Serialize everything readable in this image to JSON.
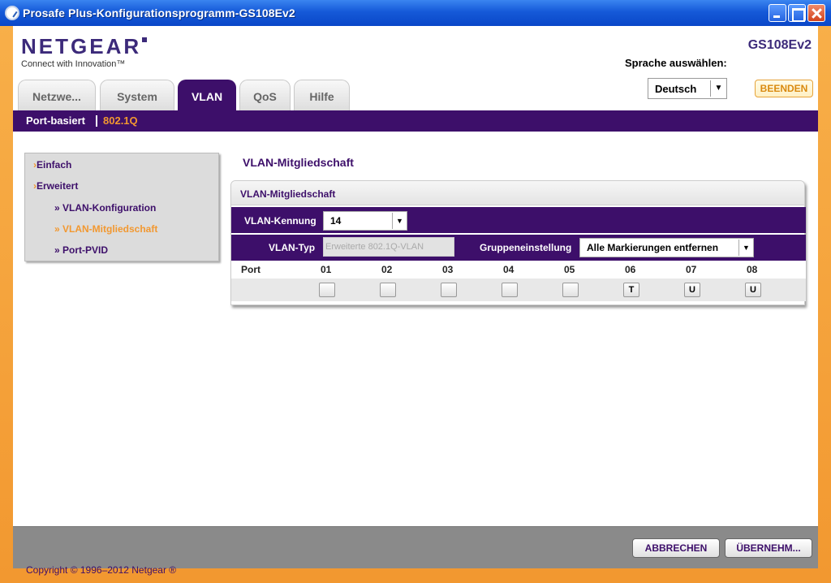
{
  "window": {
    "title": "Prosafe Plus-Konfigurationsprogramm-GS108Ev2"
  },
  "header": {
    "brand": "NETGEAR",
    "tagline": "Connect with Innovation™",
    "model": "GS108Ev2",
    "language_label": "Sprache auswählen:",
    "language_value": "Deutsch",
    "quit_label": "BEENDEN"
  },
  "tabs": [
    {
      "label": "Netzwe..."
    },
    {
      "label": "System"
    },
    {
      "label": "VLAN",
      "active": true
    },
    {
      "label": "QoS"
    },
    {
      "label": "Hilfe"
    }
  ],
  "subnav": {
    "items": [
      "Port-basiert",
      "802.1Q"
    ],
    "active": "802.1Q"
  },
  "sidebar": {
    "items": [
      {
        "label": "Einfach"
      },
      {
        "label": "Erweitert"
      },
      {
        "label": "» VLAN-Konfiguration"
      },
      {
        "label": "» VLAN-Mitgliedschaft",
        "current": true
      },
      {
        "label": "» Port-PVID"
      }
    ]
  },
  "content": {
    "title": "VLAN-Mitgliedschaft",
    "panel_title": "VLAN-Mitgliedschaft",
    "vlan_id_label": "VLAN-Kennung",
    "vlan_id_value": "14",
    "vlan_type_label": "VLAN-Typ",
    "vlan_type_value": "Erweiterte 802.1Q-VLAN",
    "group_label": "Gruppeneinstellung",
    "group_value": "Alle Markierungen entfernen",
    "port_label": "Port",
    "ports": [
      {
        "id": "01",
        "state": ""
      },
      {
        "id": "02",
        "state": ""
      },
      {
        "id": "03",
        "state": ""
      },
      {
        "id": "04",
        "state": ""
      },
      {
        "id": "05",
        "state": ""
      },
      {
        "id": "06",
        "state": "T"
      },
      {
        "id": "07",
        "state": "U"
      },
      {
        "id": "08",
        "state": "U"
      }
    ]
  },
  "footer": {
    "cancel_label": "ABBRECHEN",
    "apply_label": "ÜBERNEHM...",
    "copyright": "Copyright © 1996–2012 Netgear ®"
  },
  "colors": {
    "primary_purple": "#3d0f6a",
    "accent_orange": "#f29830",
    "window_blue": "#1559d8"
  }
}
